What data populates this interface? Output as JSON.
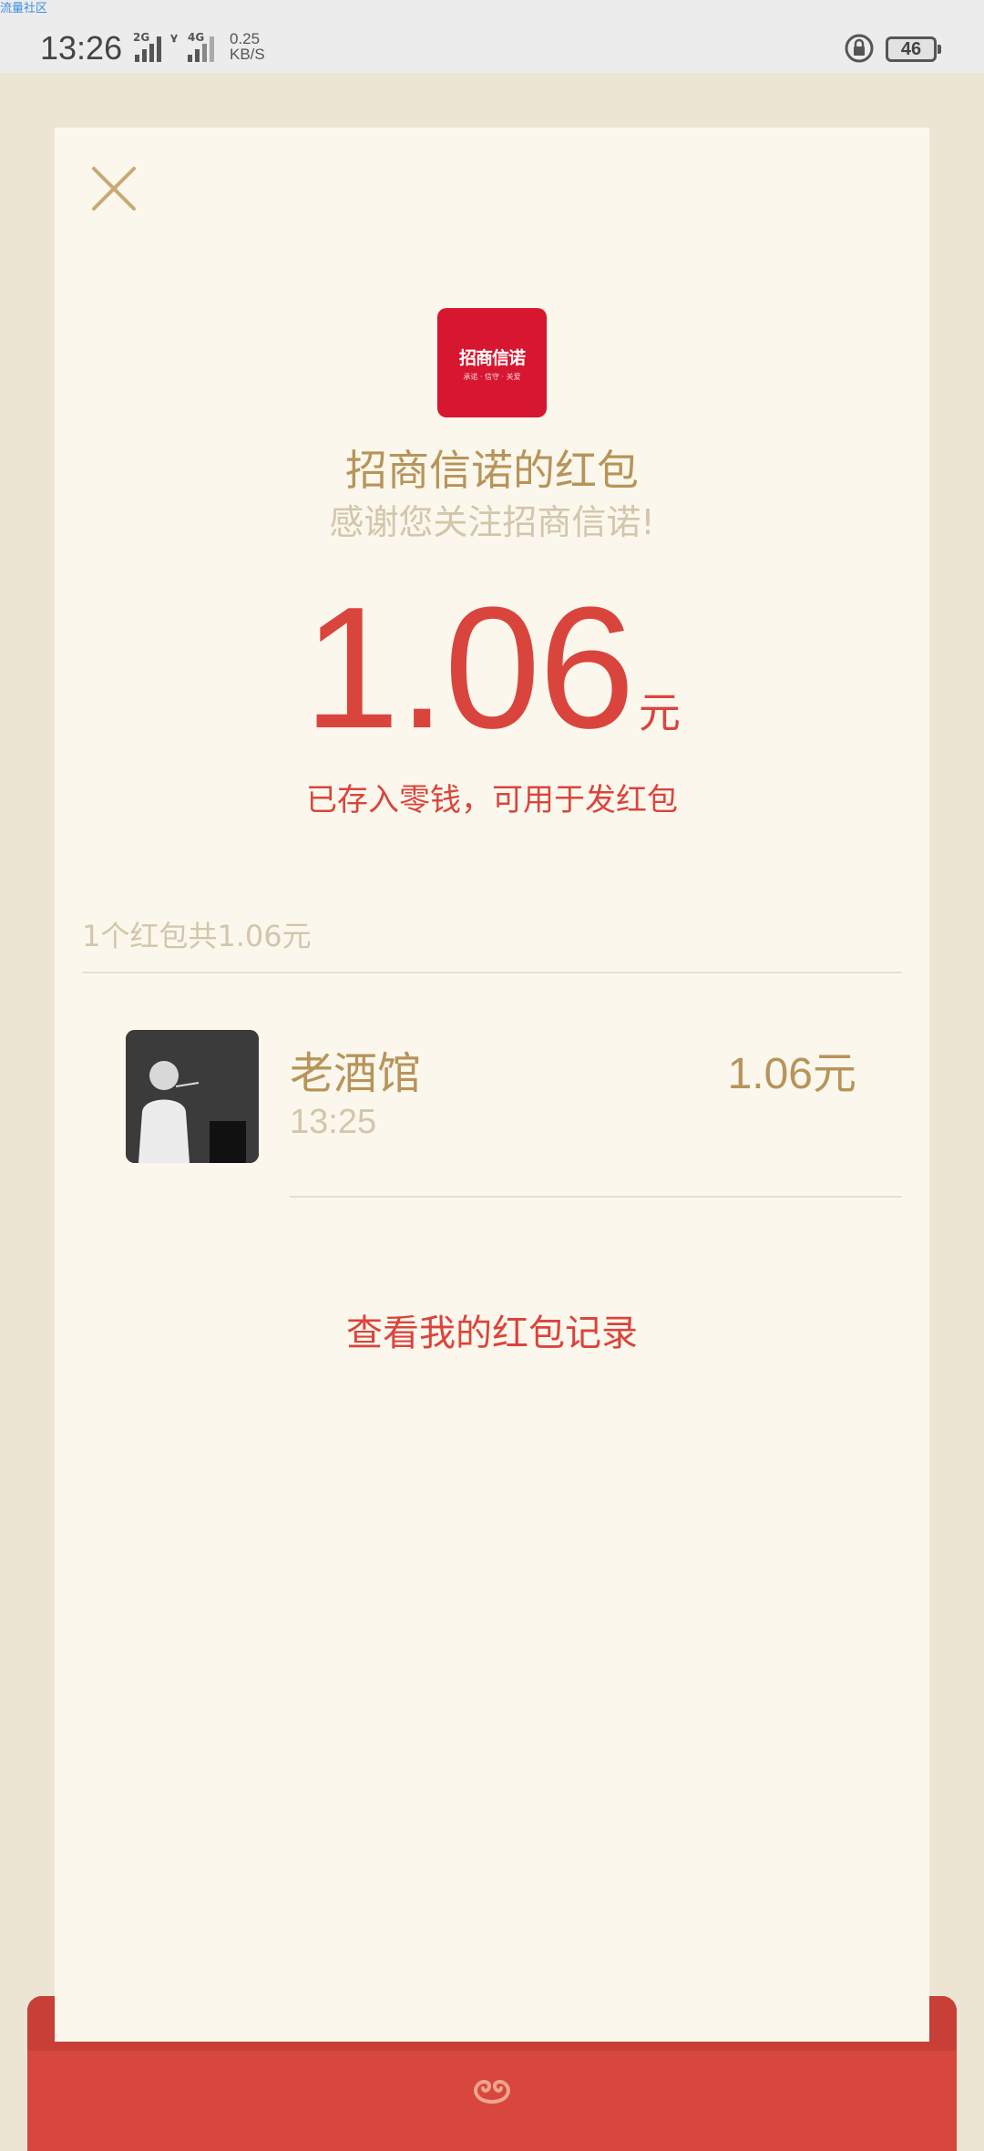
{
  "status_bar": {
    "corner_label": "流量社区",
    "time": "13:26",
    "signal1_tag": "2G",
    "signal2_tag": "4G",
    "net_speed_value": "0.25",
    "net_speed_unit": "KB/S",
    "battery": "46"
  },
  "card": {
    "logo_text": "招商信诺",
    "logo_subtext": "承诺 · 信守 · 关爱",
    "sender_title": "招商信诺的红包",
    "greeting": "感谢您关注招商信诺!",
    "amount": "1.06",
    "amount_unit": "元",
    "deposit_note": "已存入零钱，可用于发红包",
    "summary": "1个红包共1.06元",
    "entries": [
      {
        "name": "老酒馆",
        "time": "13:25",
        "amount": "1.06元"
      }
    ],
    "records_link": "查看我的红包记录"
  },
  "colors": {
    "accent_red": "#d9453d",
    "gold": "#b7945a",
    "muted": "#d2c6ab",
    "card_bg": "#fbf7ec",
    "page_bg": "#ece5d4"
  }
}
